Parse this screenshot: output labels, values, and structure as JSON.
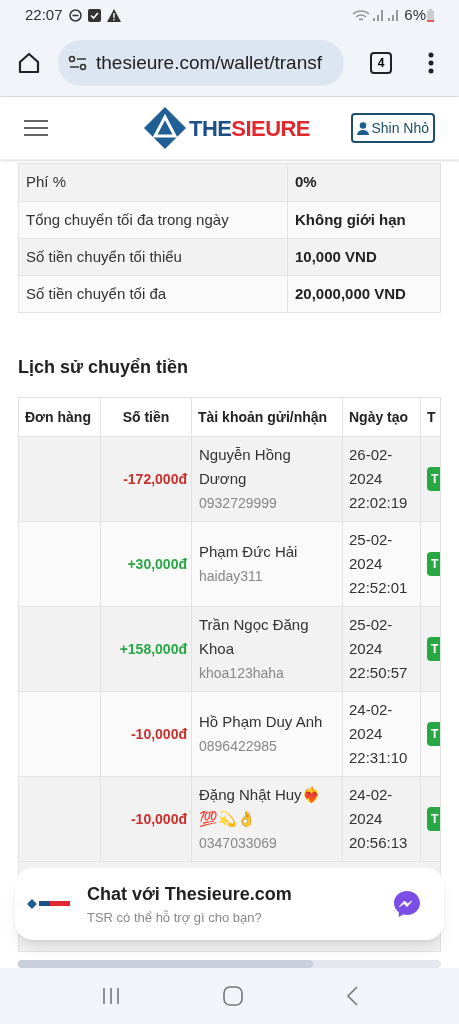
{
  "status_bar": {
    "time": "22:07",
    "battery": "6%"
  },
  "browser": {
    "url": "thesieure.com/wallet/transf",
    "tab_count": "4"
  },
  "header": {
    "logo_text_1": "THE",
    "logo_text_2": "SIEURE",
    "user_button": "Shin Nhỏ"
  },
  "info_table": [
    {
      "label": "Phí %",
      "value": "0%"
    },
    {
      "label": "Tổng chuyển tối đa trong ngày",
      "value": "Không giới hạn"
    },
    {
      "label": "Số tiền chuyển tối thiểu",
      "value": "10,000 VND"
    },
    {
      "label": "Số tiền chuyển tối đa",
      "value": "20,000,000 VND"
    }
  ],
  "history": {
    "title": "Lịch sử chuyển tiền",
    "columns": [
      "Đơn hàng",
      "Số tiền",
      "Tài khoản gửi/nhận",
      "Ngày tạo",
      "T"
    ],
    "rows": [
      {
        "amount": "-172,000đ",
        "kind": "out",
        "name": "Nguyễn Hồng Dương",
        "account": "0932729999",
        "date": "26-02-2024 22:02:19",
        "status": "T"
      },
      {
        "amount": "+30,000đ",
        "kind": "in",
        "name": "Phạm Đức Hải",
        "account": "haiday311",
        "date": "25-02-2024 22:52:01",
        "status": "T"
      },
      {
        "amount": "+158,000đ",
        "kind": "in",
        "name": "Trần Ngọc Đăng Khoa",
        "account": "khoa123haha",
        "date": "25-02-2024 22:50:57",
        "status": "T"
      },
      {
        "amount": "-10,000đ",
        "kind": "out",
        "name": "Hồ Phạm Duy Anh",
        "account": "0896422985",
        "date": "24-02-2024 22:31:10",
        "status": "T"
      },
      {
        "amount": "-10,000đ",
        "kind": "out",
        "name": "Đặng Nhật Huy❤️‍🔥💯💫👌",
        "account": "0347033069",
        "date": "24-02-2024 20:56:13",
        "status": "T"
      }
    ]
  },
  "chat_widget": {
    "title": "Chat với Thesieure.com",
    "subtitle": "TSR có thể hỗ trợ gì cho bạn?"
  }
}
